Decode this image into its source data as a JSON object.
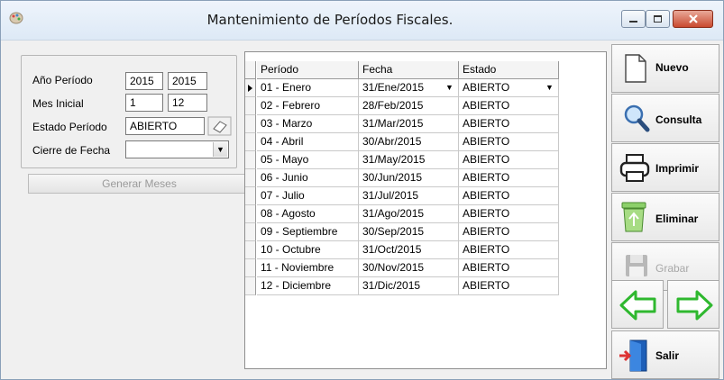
{
  "window": {
    "title": "Mantenimiento de Períodos Fiscales."
  },
  "form": {
    "anio_label": "Año Período",
    "anio_desde": "2015",
    "anio_hasta": "2015",
    "mes_label": "Mes Inicial",
    "mes_desde": "1",
    "mes_hasta": "12",
    "estado_label": "Estado Período",
    "estado_value": "ABIERTO",
    "cierre_label": "Cierre de Fecha",
    "cierre_value": "",
    "generar_label": "Generar Meses"
  },
  "grid": {
    "columns": [
      "Período",
      "Fecha",
      "Estado"
    ],
    "rows": [
      [
        "01 - Enero",
        "31/Ene/2015",
        "ABIERTO"
      ],
      [
        "02 - Febrero",
        "28/Feb/2015",
        "ABIERTO"
      ],
      [
        "03 - Marzo",
        "31/Mar/2015",
        "ABIERTO"
      ],
      [
        "04 - Abril",
        "30/Abr/2015",
        "ABIERTO"
      ],
      [
        "05 - Mayo",
        "31/May/2015",
        "ABIERTO"
      ],
      [
        "06 - Junio",
        "30/Jun/2015",
        "ABIERTO"
      ],
      [
        "07 - Julio",
        "31/Jul/2015",
        "ABIERTO"
      ],
      [
        "08 - Agosto",
        "31/Ago/2015",
        "ABIERTO"
      ],
      [
        "09 - Septiembre",
        "30/Sep/2015",
        "ABIERTO"
      ],
      [
        "10 - Octubre",
        "31/Oct/2015",
        "ABIERTO"
      ],
      [
        "11 - Noviembre",
        "30/Nov/2015",
        "ABIERTO"
      ],
      [
        "12 - Diciembre",
        "31/Dic/2015",
        "ABIERTO"
      ]
    ],
    "selected_row": 0
  },
  "actions": {
    "nuevo": "Nuevo",
    "consulta": "Consulta",
    "imprimir": "Imprimir",
    "eliminar": "Eliminar",
    "grabar": "Grabar",
    "salir": "Salir"
  },
  "icons": [
    "app-icon",
    "minimize-icon",
    "maximize-icon",
    "close-icon",
    "eraser-icon",
    "new-document-icon",
    "magnifier-icon",
    "printer-icon",
    "recycle-bin-icon",
    "floppy-disk-icon",
    "arrow-left-icon",
    "arrow-right-icon",
    "exit-door-icon"
  ],
  "colors": {
    "nav_arrow": "#2fb82f",
    "close_button": "#c94a2f",
    "disabled_text": "#a8a8a8"
  }
}
